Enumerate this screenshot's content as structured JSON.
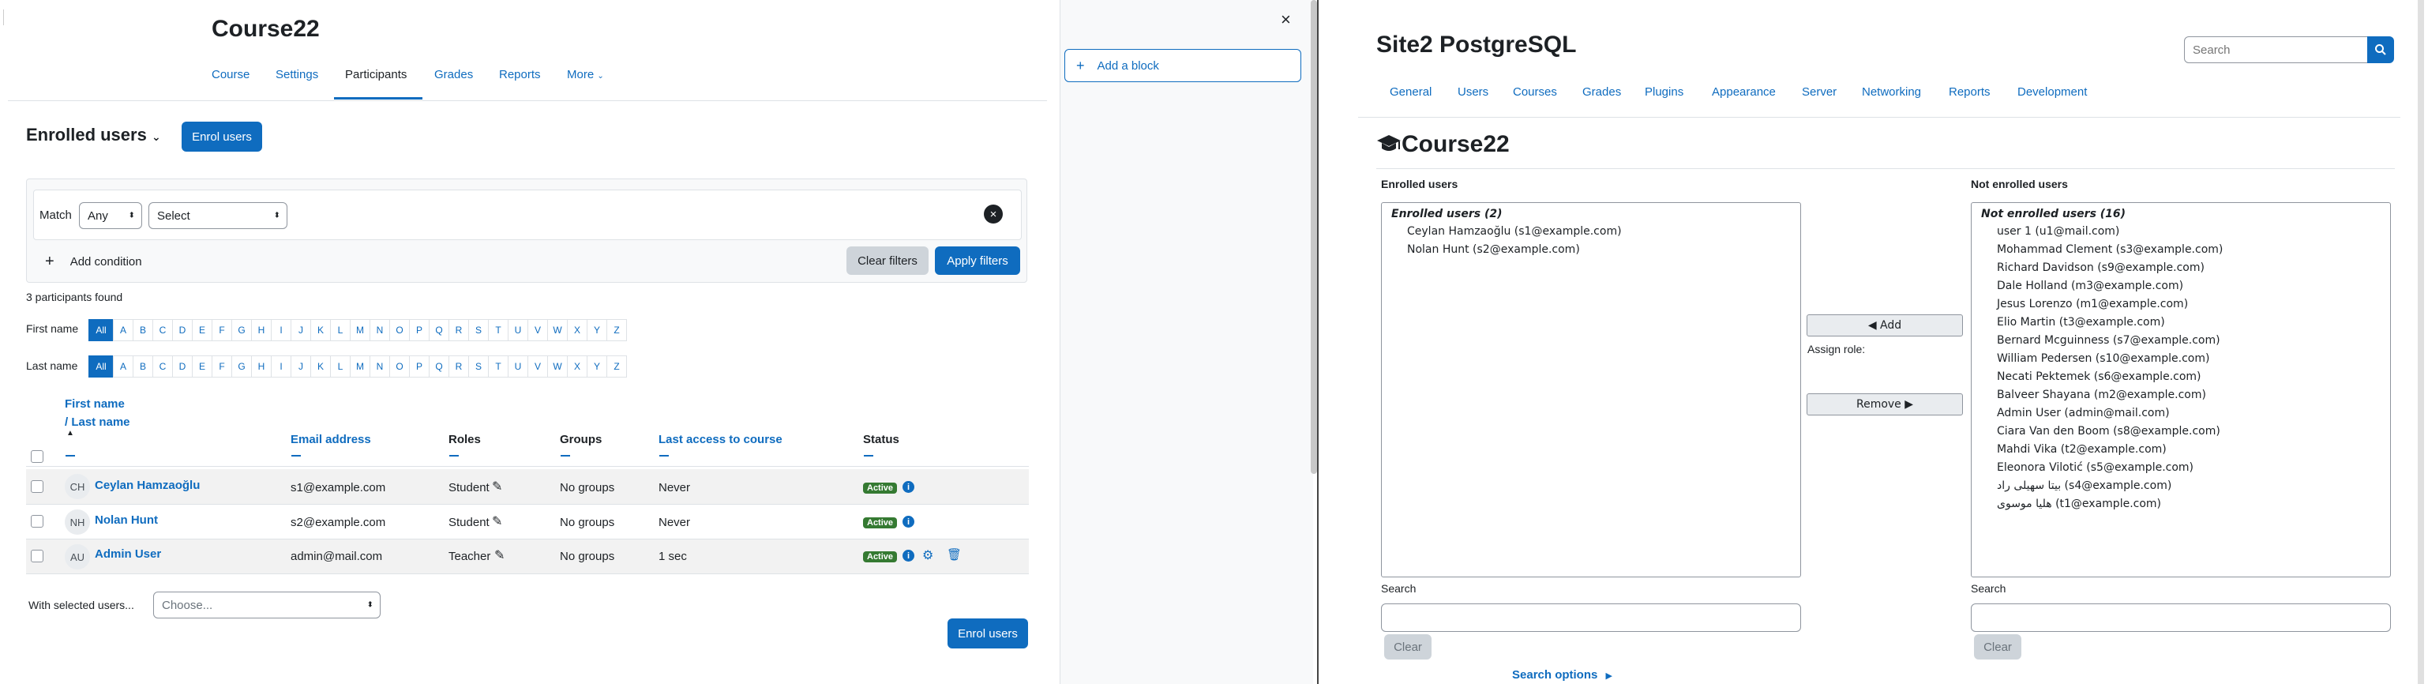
{
  "left": {
    "course_title": "Course22",
    "tabs": [
      "Course",
      "Settings",
      "Participants",
      "Grades",
      "Reports",
      "More"
    ],
    "page_heading": "Enrolled users",
    "enrol_users_top": "Enrol users",
    "filter": {
      "match_label": "Match",
      "match_value": "Any",
      "select_value": "Select",
      "add_condition": "Add condition",
      "clear_filters": "Clear filters",
      "apply_filters": "Apply filters"
    },
    "participants_found": "3 participants found",
    "first_name_label": "First name",
    "last_name_label": "Last name",
    "letters": [
      "All",
      "A",
      "B",
      "C",
      "D",
      "E",
      "F",
      "G",
      "H",
      "I",
      "J",
      "K",
      "L",
      "M",
      "N",
      "O",
      "P",
      "Q",
      "R",
      "S",
      "T",
      "U",
      "V",
      "W",
      "X",
      "Y",
      "Z"
    ],
    "table": {
      "headers": {
        "first_name": "First name",
        "last_name": "/ Last name",
        "email": "Email address",
        "roles": "Roles",
        "groups": "Groups",
        "last_access": "Last access to course",
        "status": "Status"
      },
      "rows": [
        {
          "initials": "CH",
          "name": "Ceylan Hamzaoğlu",
          "email": "s1@example.com",
          "role": "Student",
          "groups": "No groups",
          "last_access": "Never",
          "status": "Active"
        },
        {
          "initials": "NH",
          "name": "Nolan Hunt",
          "email": "s2@example.com",
          "role": "Student",
          "groups": "No groups",
          "last_access": "Never",
          "status": "Active"
        },
        {
          "initials": "AU",
          "name": "Admin User",
          "email": "admin@mail.com",
          "role": "Teacher",
          "groups": "No groups",
          "last_access": "1 sec",
          "status": "Active"
        }
      ]
    },
    "with_selected_label": "With selected users...",
    "choose_placeholder": "Choose...",
    "enrol_users_bottom": "Enrol users"
  },
  "drawer": {
    "close_glyph": "×",
    "add_block": "Add a block"
  },
  "right": {
    "site_title": "Site2 PostgreSQL",
    "search_placeholder": "Search",
    "tabs": [
      "General",
      "Users",
      "Courses",
      "Grades",
      "Plugins",
      "Appearance",
      "Server",
      "Networking",
      "Reports",
      "Development"
    ],
    "course_heading": "Course22",
    "enrolled_header": "Enrolled users",
    "not_enrolled_header": "Not enrolled users",
    "enrolled_group": "Enrolled users (2)",
    "enrolled": [
      "Ceylan Hamzaoğlu (s1@example.com)",
      "Nolan Hunt (s2@example.com)"
    ],
    "not_enrolled_group": "Not enrolled users (16)",
    "not_enrolled": [
      "user 1 (u1@mail.com)",
      "Mohammad Clement (s3@example.com)",
      "Richard Davidson (s9@example.com)",
      "Dale Holland (m3@example.com)",
      "Jesus Lorenzo (m1@example.com)",
      "Elio Martin (t3@example.com)",
      "Bernard Mcguinness (s7@example.com)",
      "William Pedersen (s10@example.com)",
      "Necati Pektemek (s6@example.com)",
      "Balveer Shayana (m2@example.com)",
      "Admin User (admin@mail.com)",
      "Ciara Van den Boom (s8@example.com)",
      "Mahdi Vika (t2@example.com)",
      "Eleonora Vilotić (s5@example.com)",
      "بیتا سهیلی راد (s4@example.com)",
      "هلیا موسوی (t1@example.com)"
    ],
    "add_button": "◀ Add",
    "assign_role": "Assign role:",
    "remove_button": "Remove ▶",
    "search_label": "Search",
    "clear_button": "Clear",
    "search_options": "Search options"
  }
}
